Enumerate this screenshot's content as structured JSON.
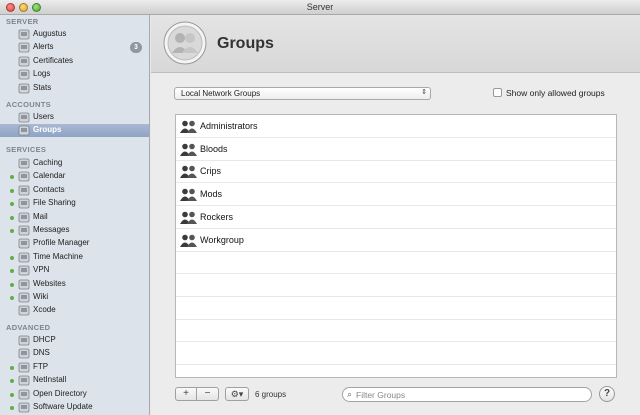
{
  "window": {
    "title": "Server"
  },
  "sidebar": {
    "sections": [
      {
        "label": "SERVER",
        "items": [
          {
            "label": "Augustus",
            "icon": "computer-icon",
            "dot": false
          },
          {
            "label": "Alerts",
            "icon": "alert-icon",
            "dot": false,
            "badge": "3"
          },
          {
            "label": "Certificates",
            "icon": "certificate-icon",
            "dot": false
          },
          {
            "label": "Logs",
            "icon": "log-icon",
            "dot": false
          },
          {
            "label": "Stats",
            "icon": "stats-icon",
            "dot": false
          }
        ]
      },
      {
        "label": "ACCOUNTS",
        "items": [
          {
            "label": "Users",
            "icon": "user-icon",
            "dot": false
          },
          {
            "label": "Groups",
            "icon": "group-icon",
            "dot": false,
            "selected": true
          }
        ]
      },
      {
        "label": "SERVICES",
        "items": [
          {
            "label": "Caching",
            "icon": "caching-icon",
            "dot": false
          },
          {
            "label": "Calendar",
            "icon": "calendar-icon",
            "dot": true
          },
          {
            "label": "Contacts",
            "icon": "contacts-icon",
            "dot": true
          },
          {
            "label": "File Sharing",
            "icon": "folder-icon",
            "dot": true
          },
          {
            "label": "Mail",
            "icon": "mail-icon",
            "dot": true
          },
          {
            "label": "Messages",
            "icon": "messages-icon",
            "dot": true
          },
          {
            "label": "Profile Manager",
            "icon": "profile-icon",
            "dot": false
          },
          {
            "label": "Time Machine",
            "icon": "time-machine-icon",
            "dot": true
          },
          {
            "label": "VPN",
            "icon": "vpn-icon",
            "dot": true
          },
          {
            "label": "Websites",
            "icon": "globe-icon",
            "dot": true
          },
          {
            "label": "Wiki",
            "icon": "wiki-icon",
            "dot": true
          },
          {
            "label": "Xcode",
            "icon": "hammer-icon",
            "dot": false
          }
        ]
      },
      {
        "label": "ADVANCED",
        "items": [
          {
            "label": "DHCP",
            "icon": "dhcp-icon",
            "dot": false
          },
          {
            "label": "DNS",
            "icon": "dns-icon",
            "dot": false
          },
          {
            "label": "FTP",
            "icon": "ftp-icon",
            "dot": true
          },
          {
            "label": "NetInstall",
            "icon": "netinstall-icon",
            "dot": true
          },
          {
            "label": "Open Directory",
            "icon": "directory-icon",
            "dot": true
          },
          {
            "label": "Software Update",
            "icon": "update-icon",
            "dot": true
          }
        ]
      }
    ]
  },
  "main": {
    "title": "Groups",
    "group_select": "Local Network Groups",
    "show_only_allowed_label": "Show only allowed groups",
    "groups": [
      "Administrators",
      "Bloods",
      "Crips",
      "Mods",
      "Rockers",
      "Workgroup"
    ],
    "empty_rows": 6,
    "add_label": "+",
    "remove_label": "−",
    "gear_label": "⚙▾",
    "count_label": "6 groups",
    "search_placeholder": "Filter Groups",
    "help_label": "?"
  },
  "colors": {
    "selection": "#9aabc9",
    "status_dot": "#5fae46",
    "sidebar_bg": "#dde3ea"
  }
}
